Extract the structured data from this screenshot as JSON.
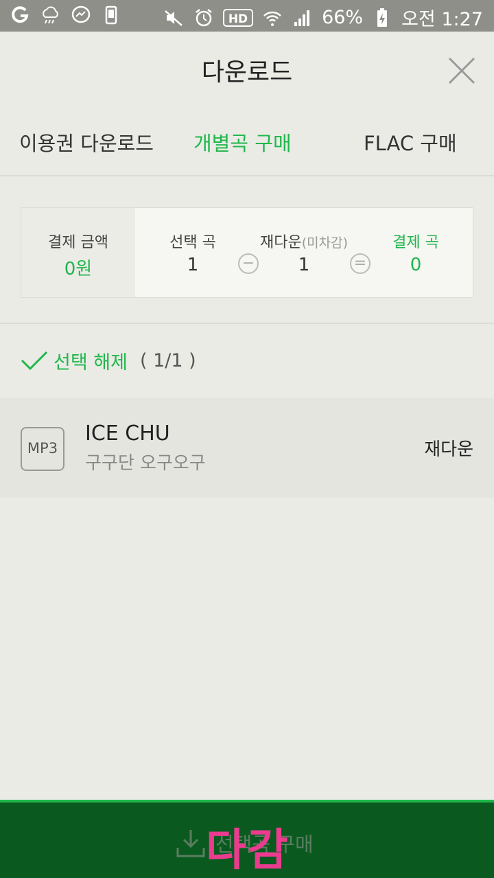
{
  "status_bar": {
    "battery": "66%",
    "time": "오전 1:27",
    "left_icons": [
      "g-app-icon",
      "cloud-rain-icon",
      "messenger-icon",
      "phone-icon"
    ],
    "right_icons": [
      "mute-icon",
      "alarm-icon",
      "hd-icon",
      "wifi-icon",
      "signal-icon",
      "battery-charging-icon"
    ],
    "hd_label": "HD"
  },
  "header": {
    "title": "다운로드"
  },
  "tabs": [
    {
      "label": "이용권 다운로드",
      "active": false
    },
    {
      "label": "개별곡 구매",
      "active": true
    },
    {
      "label": "FLAC 구매",
      "active": false
    }
  ],
  "summary": {
    "payment": {
      "label": "결제 금액",
      "value": "0원"
    },
    "selected": {
      "label": "선택 곡",
      "value": "1"
    },
    "redownload": {
      "label": "재다운",
      "note": "(미차감)",
      "value": "1"
    },
    "pay_songs": {
      "label": "결제 곡",
      "value": "0"
    },
    "minus": "−",
    "equals": "="
  },
  "selection": {
    "label": "선택 해제",
    "count": "( 1/1 )"
  },
  "songs": [
    {
      "format": "MP3",
      "title": "ICE CHU",
      "artist": "구구단 오구오구",
      "status": "재다운"
    }
  ],
  "bottom": {
    "label": "선택곡 구매",
    "overlay": "다감"
  },
  "colors": {
    "accent": "#1fb74b",
    "bottom_bar": "#0a5a20",
    "overlay": "#ea3b8f"
  }
}
